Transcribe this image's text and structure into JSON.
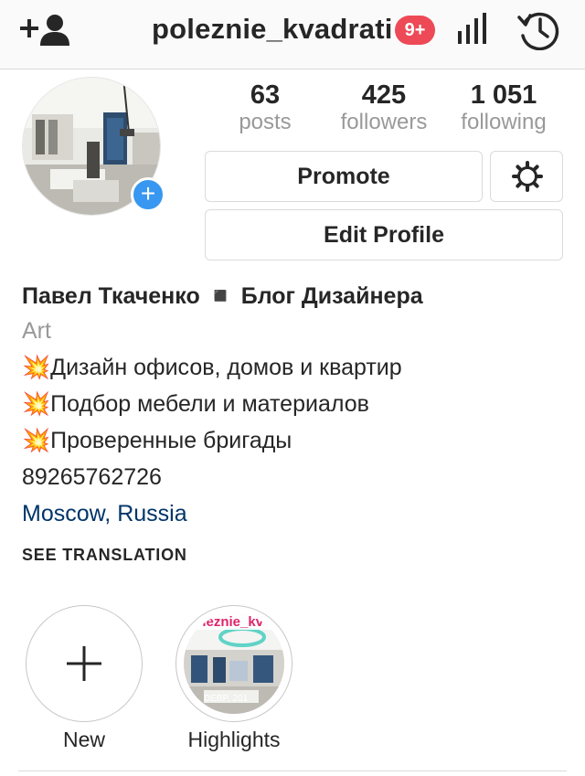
{
  "header": {
    "username": "poleznie_kvadrati",
    "notification_badge": "9+",
    "badge_color": "#ed4956",
    "add_user_icon": "add-user-icon",
    "stats_icon": "bar-chart-icon",
    "history_icon": "history-clock-icon"
  },
  "profile": {
    "avatar_alt": "profile photo",
    "stats": [
      {
        "value": "63",
        "label": "posts"
      },
      {
        "value": "425",
        "label": "followers"
      },
      {
        "value": "1 051",
        "label": "following"
      }
    ],
    "promote_label": "Promote",
    "edit_label": "Edit Profile",
    "settings_icon": "gear-icon"
  },
  "bio": {
    "name": "Павел Ткаченко ◾️ Блог Дизайнера",
    "category": "Art",
    "lines": [
      {
        "emoji": "💥",
        "text": "Дизайн офисов, домов и квартир"
      },
      {
        "emoji": "💥",
        "text": "Подбор мебели и материалов"
      },
      {
        "emoji": "💥",
        "text": "Проверенные бригады"
      }
    ],
    "phone": "89265762726",
    "location": "Moscow, Russia",
    "see_translation": "SEE TRANSLATION"
  },
  "highlights": [
    {
      "label": "New",
      "icon": "plus-icon"
    },
    {
      "label": "Highlights",
      "cover_text": "poleznie_kv",
      "watermark": "DEBP, 201"
    }
  ],
  "colors": {
    "accent_blue": "#3897f0",
    "link": "#003569",
    "muted": "#999999",
    "border": "#dbdbdb"
  }
}
